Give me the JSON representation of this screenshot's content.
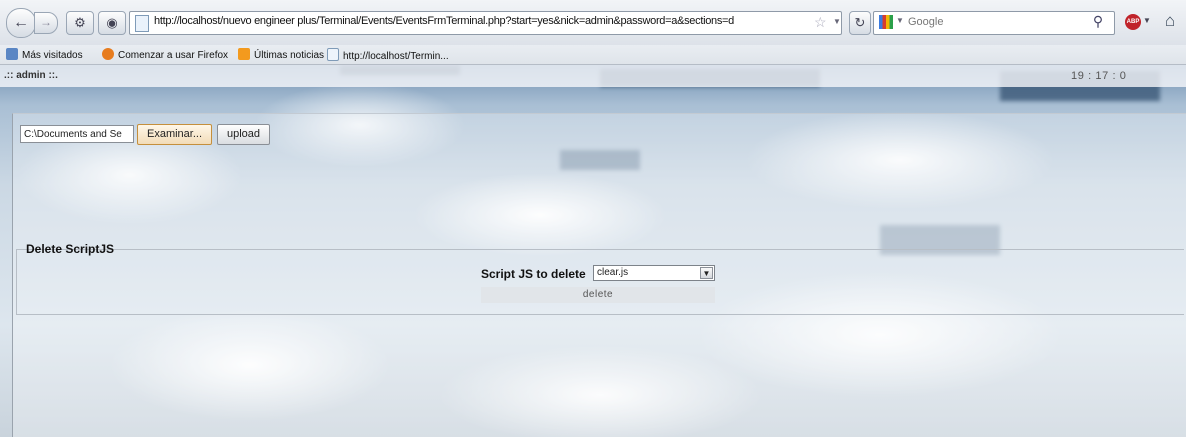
{
  "browser": {
    "url": "http://localhost/nuevo engineer plus/Terminal/Events/EventsFrmTerminal.php?start=yes&nick=admin&password=a&sections=deleteScriptJS_unRegiste",
    "search_placeholder": "Google",
    "bookmarks": [
      {
        "label": "Más visitados",
        "icon": "most-visited-icon"
      },
      {
        "label": "Comenzar a usar Firefox",
        "icon": "firefox-icon"
      },
      {
        "label": "Últimas noticias",
        "icon": "rss-icon"
      },
      {
        "label": "http://localhost/Termin...",
        "icon": "page-icon"
      }
    ]
  },
  "header": {
    "user": ".:: admin ::.",
    "time": "19 : 17 : 0"
  },
  "upload": {
    "file_value": "C:\\Documents and Se",
    "browse_label": "Examinar...",
    "upload_label": "upload"
  },
  "delete_section": {
    "legend": "Delete ScriptJS",
    "label": "Script JS to delete",
    "selected": "clear.js",
    "delete_label": "delete"
  }
}
